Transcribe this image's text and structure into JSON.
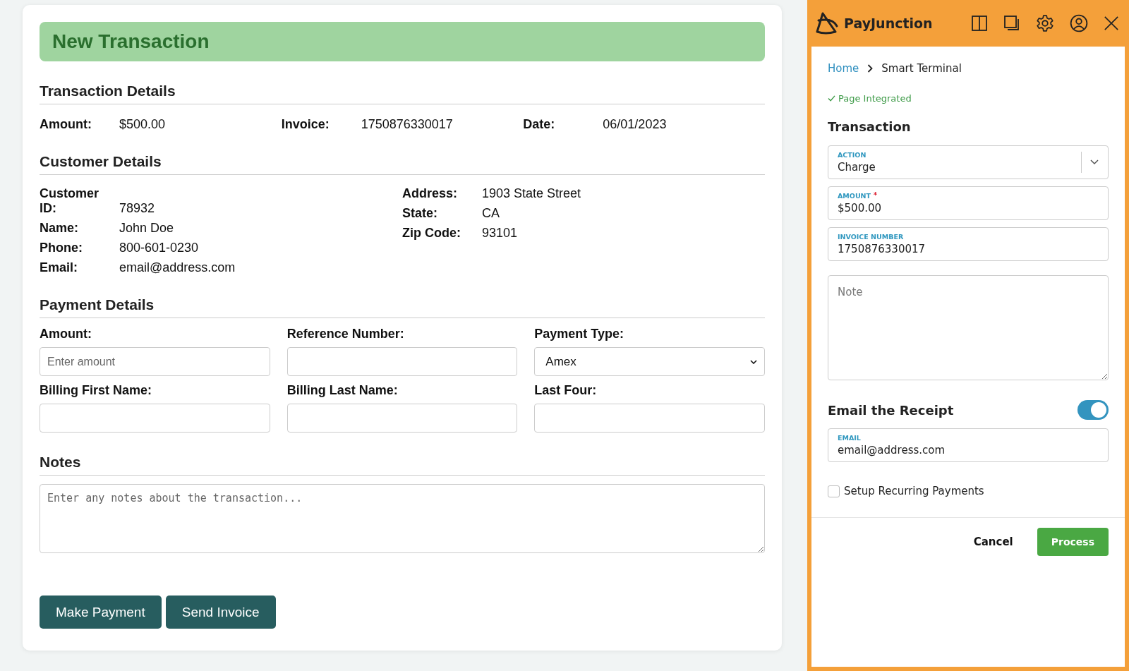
{
  "form": {
    "title": "New Transaction",
    "transaction_details": {
      "heading": "Transaction Details",
      "fields": [
        {
          "label": "Amount:",
          "value": "$500.00"
        },
        {
          "label": "Invoice:",
          "value": "1750876330017"
        },
        {
          "label": "Date:",
          "value": "06/01/2023"
        }
      ]
    },
    "customer_details": {
      "heading": "Customer Details",
      "left": [
        {
          "label": "Customer ID:",
          "value": "78932"
        },
        {
          "label": "Name:",
          "value": "John Doe"
        },
        {
          "label": "Phone:",
          "value": "800-601-0230"
        },
        {
          "label": "Email:",
          "value": "email@address.com"
        }
      ],
      "right": [
        {
          "label": "Address:",
          "value": "1903 State Street"
        },
        {
          "label": "State:",
          "value": "CA"
        },
        {
          "label": "Zip Code:",
          "value": "93101"
        }
      ]
    },
    "payment_details": {
      "heading": "Payment Details",
      "fields": [
        {
          "label": "Amount:",
          "kind": "input",
          "placeholder": "Enter amount"
        },
        {
          "label": "Reference Number:",
          "kind": "input"
        },
        {
          "label": "Payment Type:",
          "kind": "select",
          "value": "Amex"
        },
        {
          "label": "Billing First Name:",
          "kind": "input"
        },
        {
          "label": "Billing Last Name:",
          "kind": "input"
        },
        {
          "label": "Last Four:",
          "kind": "input"
        }
      ]
    },
    "notes": {
      "heading": "Notes",
      "placeholder": "Enter any notes about the transaction..."
    },
    "buttons": [
      "Make Payment",
      "Send Invoice"
    ]
  },
  "panel": {
    "brand": "PayJunction",
    "breadcrumb": {
      "home": "Home",
      "current": "Smart Terminal"
    },
    "status": "Page Integrated",
    "section": "Transaction",
    "fields": [
      {
        "kind": "select",
        "label": "ACTION",
        "value": "Charge",
        "required": false
      },
      {
        "kind": "input",
        "label": "AMOUNT",
        "value": "$500.00",
        "required": true
      },
      {
        "kind": "input",
        "label": "INVOICE NUMBER",
        "value": "1750876330017",
        "required": false
      }
    ],
    "note_placeholder": "Note",
    "email_receipt": {
      "label": "Email the Receipt",
      "on": true
    },
    "email_field": {
      "label": "EMAIL",
      "value": "email@address.com"
    },
    "recurring": {
      "label": "Setup Recurring Payments",
      "checked": false
    },
    "cancel": "Cancel",
    "process": "Process"
  }
}
